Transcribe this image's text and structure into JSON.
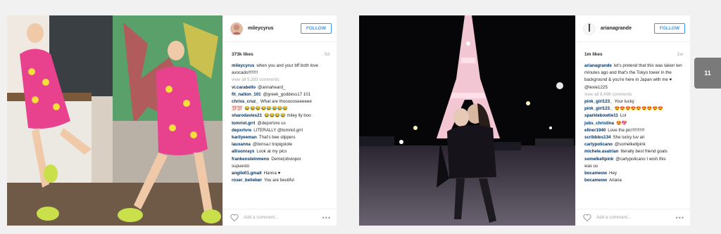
{
  "posts": [
    {
      "username": "mileycyrus",
      "follow_label": "FOLLOW",
      "likes": "373k likes",
      "time_ago": "5d",
      "caption": {
        "user": "mileycyrus",
        "text": "when you and your bff both love avocado!!!!!!!!"
      },
      "view_all": "view all 5,383 comments",
      "comments": [
        {
          "user": "vi.carabello",
          "text": "@annaheard_"
        },
        {
          "user": "fit_nation_101",
          "text": "@greek_goddess17 101"
        },
        {
          "user": "chriss_cruz_",
          "text": "What are thoooooseeeeee"
        },
        {
          "user": "💯💯",
          "text": "😂😂😂😂😂😂😂😂"
        },
        {
          "user": "sharodavies21",
          "text": "😂😂😂😂 miley lly boo"
        },
        {
          "user": "tomriot.grrl",
          "text": "@depxrtvre us"
        },
        {
          "user": "depxrtvre",
          "text": "LITERALLY @tomriot.grrl"
        },
        {
          "user": "karilyeeman",
          "text": "That's bee slippers"
        },
        {
          "user": "lauxanna",
          "text": "@ilonsa.l tropigoiote"
        },
        {
          "user": "allisonrayx",
          "text": "Look at my pics"
        },
        {
          "user": "frankenstelnmeno",
          "text": "Deme(obviopor"
        },
        {
          "user": "",
          "text": "supuesto"
        },
        {
          "user": "angile01.gmall",
          "text": "Hanna ♥"
        },
        {
          "user": "roser_beliebør",
          "text": "You are beutiful"
        }
      ],
      "add_comment": "Add a comment...",
      "more": "•••"
    },
    {
      "username": "arianagrande",
      "follow_label": "FOLLOW",
      "likes": "1m likes",
      "time_ago": "1w",
      "caption": {
        "user": "arianagrande",
        "text": "let's pretend that this was taken ten minutes ago and that's the Tokyo tower in the background & you're here in Japan with me ♥ @lexie1225"
      },
      "view_all": "view all 6,498 comments",
      "comments": [
        {
          "user": "pink_girl123_",
          "text": "Your lucky"
        },
        {
          "user": "pink_girl123_",
          "text": "😍😍😍😍😍😍😍😍😍"
        },
        {
          "user": "sparklebowtie11",
          "text": "Lol"
        },
        {
          "user": "jubs_christina",
          "text": "😍💖"
        },
        {
          "user": "ellner1940",
          "text": "Love the pic!!!!!!!!!!!"
        },
        {
          "user": "scribbles134",
          "text": "She lucky luv ari"
        },
        {
          "user": "carlypolicano",
          "text": "@somelkeltpink"
        },
        {
          "user": "michele.asatrian",
          "text": "literally best friend goals"
        },
        {
          "user": "somelkeltpink",
          "text": "@carlypolicano I wish this"
        },
        {
          "user": "",
          "text": "was us"
        },
        {
          "user": "bocameow",
          "text": "Hey"
        },
        {
          "user": "bocameow",
          "text": "Ariana"
        }
      ],
      "add_comment": "Add a comment...",
      "more": "•••"
    }
  ],
  "page_number": "11",
  "colors": {
    "link": "#3897f0",
    "username": "#003569",
    "muted": "#a5a5a5"
  }
}
